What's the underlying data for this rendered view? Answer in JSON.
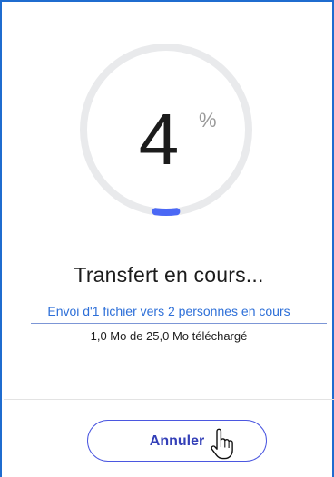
{
  "progress": {
    "percent_value": "4",
    "percent_sign": "%",
    "fraction": 0.04
  },
  "status": {
    "title": "Transfert en cours...",
    "send_info": "Envoi d'1 fichier vers 2 personnes en cours",
    "size_info": "1,0 Mo de 25,0 Mo téléchargé"
  },
  "actions": {
    "cancel_label": "Annuler"
  },
  "colors": {
    "accent": "#4b68f5",
    "ring_track": "#e9eaec",
    "link": "#2d6fd8",
    "frame_border": "#1f6ccf",
    "button_border": "#4b57e0",
    "button_text": "#3440b8"
  },
  "icons": {
    "cursor": "hand-pointer-icon"
  }
}
